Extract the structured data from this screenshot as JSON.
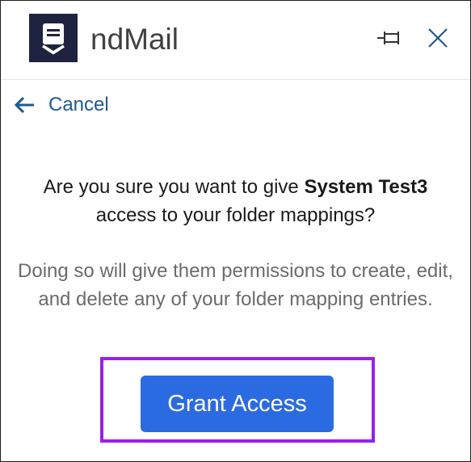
{
  "app": {
    "title": "ndMail"
  },
  "header": {
    "icons": {
      "logo": "ndmail-logo-icon",
      "pin": "pin-icon",
      "close": "close-icon"
    }
  },
  "nav": {
    "back_label": "Cancel",
    "back_icon": "arrow-left-icon"
  },
  "dialog": {
    "question_prefix": "Are you sure you want to give ",
    "question_user": "System Test3",
    "question_suffix": " access to your folder mappings?",
    "note": "Doing so will give them permissions to create, edit, and delete any of your folder mapping entries.",
    "grant_button": "Grant Access"
  },
  "colors": {
    "accent": "#2b6be2",
    "link": "#1f5a8c",
    "logo_bg": "#1e2340",
    "highlight": "#9b1fe8"
  }
}
